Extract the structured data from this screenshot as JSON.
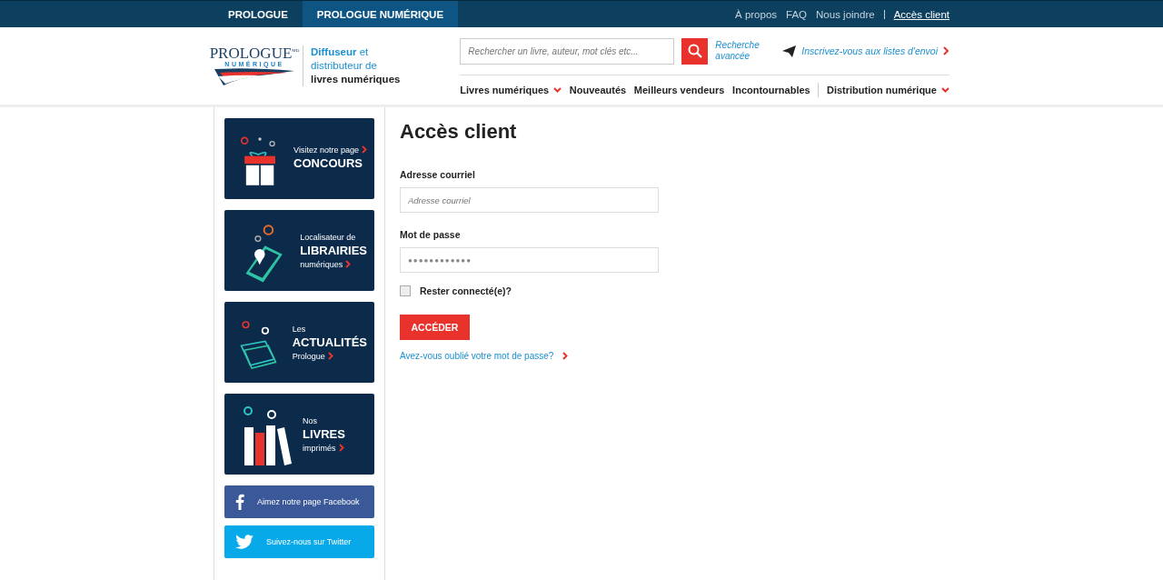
{
  "top_bar": {
    "sites": [
      {
        "label": "PROLOGUE",
        "selected": false
      },
      {
        "label": "PROLOGUE NUMÉRIQUE",
        "selected": true
      }
    ],
    "links": [
      {
        "label": "À propos",
        "current": false
      },
      {
        "label": "FAQ",
        "current": false
      },
      {
        "label": "Nous joindre",
        "current": false
      },
      {
        "label": "Accès client",
        "current": true
      }
    ]
  },
  "header": {
    "logo": {
      "line_1": "PROLOGUE",
      "mark": "MD",
      "line_2": "NUMÉRIQUE"
    },
    "tagline": "**Diffuseur** et distributeur de **livres numériques**",
    "search": {
      "placeholder": "Rechercher un livre, auteur, mot clés etc..."
    },
    "advanced_search": "Recherche avancée",
    "newsletter": "Inscrivez-vous aux listes d'envoi",
    "nav": [
      {
        "label": "Livres numériques",
        "dropdown": true
      },
      {
        "label": "Nouveautés",
        "dropdown": false
      },
      {
        "label": "Meilleurs vendeurs",
        "dropdown": false
      },
      {
        "label": "Incontournables",
        "dropdown": false
      },
      {
        "label": "Distribution numérique",
        "dropdown": true
      }
    ]
  },
  "sidebar": {
    "promos": [
      {
        "kind": "gift",
        "lines": [
          {
            "text": "Visitez notre page",
            "kind": "caption",
            "arrow": true
          },
          {
            "text": "CONCOURS",
            "kind": "heading",
            "arrow": false
          }
        ]
      },
      {
        "kind": "phone",
        "lines": [
          {
            "text": "Localisateur de",
            "kind": "caption",
            "arrow": false
          },
          {
            "text": "LIBRAIRIES",
            "kind": "heading",
            "arrow": false
          },
          {
            "text": "numériques",
            "kind": "caption",
            "arrow": true
          }
        ]
      },
      {
        "kind": "papers",
        "lines": [
          {
            "text": "Les",
            "kind": "caption",
            "arrow": false
          },
          {
            "text": "ACTUALITÉS",
            "kind": "heading",
            "arrow": false
          },
          {
            "text": "Prologue",
            "kind": "caption",
            "arrow": true
          }
        ]
      },
      {
        "kind": "books",
        "lines": [
          {
            "text": "Nos",
            "kind": "caption",
            "arrow": false
          },
          {
            "text": "LIVRES",
            "kind": "heading",
            "arrow": false
          },
          {
            "text": "imprimés",
            "kind": "caption",
            "arrow": true
          }
        ]
      }
    ],
    "social": [
      {
        "kind": "facebook",
        "label": "Aimez notre page Facebook"
      },
      {
        "kind": "twitter",
        "label": "Suivez-nous sur Twitter"
      }
    ]
  },
  "form": {
    "title": "Accès client",
    "fields": [
      {
        "label": "Adresse courriel",
        "placeholder": "Adresse courriel",
        "kind": "email"
      },
      {
        "label": "Mot de passe",
        "value": "●●●●●●●●●●●●",
        "kind": "password"
      }
    ],
    "remember": {
      "label": "Rester connecté(e)?",
      "checked": false
    },
    "submit": "ACCÉDER",
    "forgot": "Avez-vous oublié votre mot de passe?"
  }
}
